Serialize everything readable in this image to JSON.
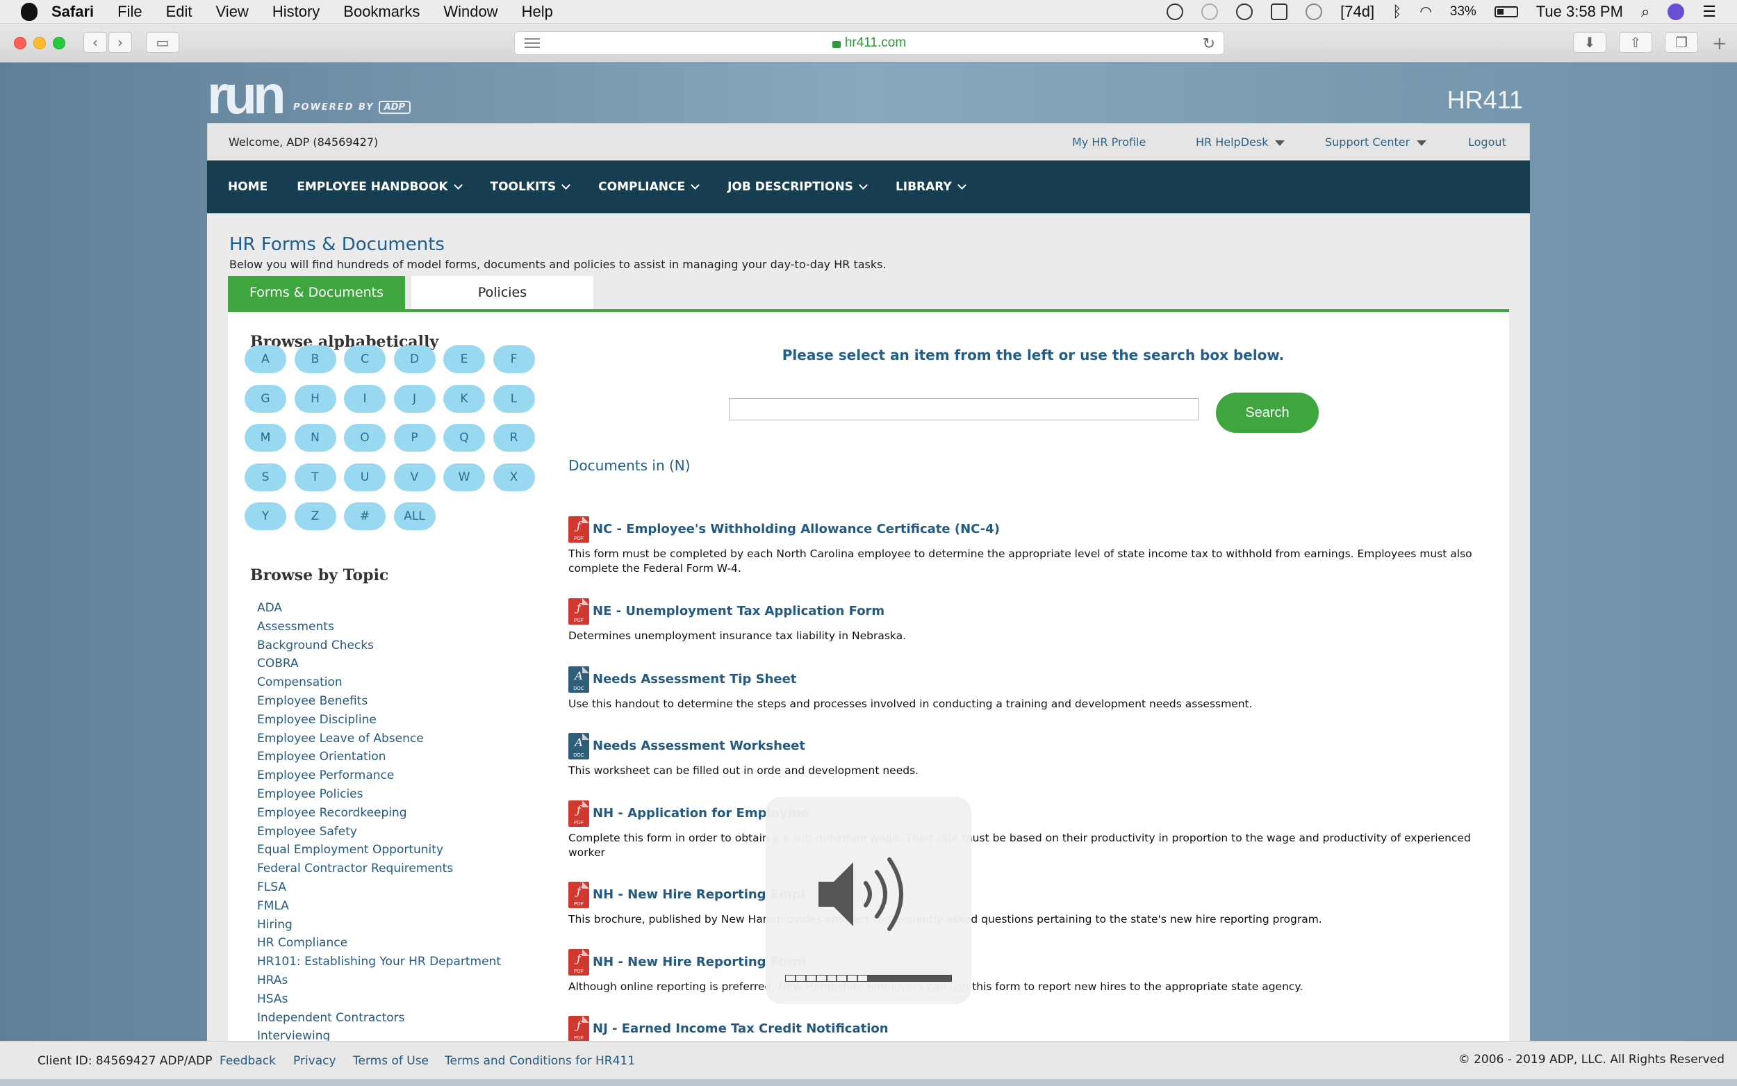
{
  "menubar": {
    "items": [
      "Safari",
      "File",
      "Edit",
      "View",
      "History",
      "Bookmarks",
      "Window",
      "Help"
    ],
    "status_text": "[74d]",
    "battery": "33%",
    "clock": "Tue 3:58 PM"
  },
  "browser": {
    "url": "hr411.com"
  },
  "brand": {
    "logo": "run",
    "powered": "POWERED BY",
    "adp": "ADP",
    "product": "HR411"
  },
  "utility": {
    "welcome": "Welcome, ADP (84569427)",
    "links": [
      "My HR Profile",
      "HR HelpDesk",
      "Support Center",
      "Logout"
    ]
  },
  "nav": {
    "items": [
      "HOME",
      "EMPLOYEE HANDBOOK",
      "TOOLKITS",
      "COMPLIANCE",
      "JOB DESCRIPTIONS",
      "LIBRARY"
    ]
  },
  "main": {
    "title": "HR Forms & Documents",
    "subtitle": "Below you will find hundreds of model forms, documents and policies to assist in managing your day-to-day HR tasks.",
    "tabs": [
      "Forms & Documents",
      "Policies"
    ],
    "browse_alpha_heading": "Browse alphabetically",
    "letters": [
      "A",
      "B",
      "C",
      "D",
      "E",
      "F",
      "G",
      "H",
      "I",
      "J",
      "K",
      "L",
      "M",
      "N",
      "O",
      "P",
      "Q",
      "R",
      "S",
      "T",
      "U",
      "V",
      "W",
      "X",
      "Y",
      "Z",
      "#",
      "ALL"
    ],
    "browse_topic_heading": "Browse by Topic",
    "topics": [
      "ADA",
      "Assessments",
      "Background Checks",
      "COBRA",
      "Compensation",
      "Employee Benefits",
      "Employee Discipline",
      "Employee Leave of Absence",
      "Employee Orientation",
      "Employee Performance",
      "Employee Policies",
      "Employee Recordkeeping",
      "Employee Safety",
      "Equal Employment Opportunity",
      "Federal Contractor Requirements",
      "FLSA",
      "FMLA",
      "Hiring",
      "HR Compliance",
      "HR101: Establishing Your HR Department",
      "HRAs",
      "HSAs",
      "Independent Contractors",
      "Interviewing"
    ],
    "prompt": "Please select an item from the left or use the search box below.",
    "search_placeholder": "",
    "search_button": "Search",
    "docs_heading": "Documents in (N)",
    "documents": [
      {
        "type": "pdf",
        "title": "NC - Employee's Withholding Allowance Certificate (NC-4)",
        "desc": "This form must be completed by each North Carolina employee to determine the appropriate level of state income tax to withhold from earnings. Employees must also complete the Federal Form W-4."
      },
      {
        "type": "pdf",
        "title": "NE - Unemployment Tax Application Form",
        "desc": "Determines unemployment insurance tax liability in Nebraska."
      },
      {
        "type": "doc",
        "title": "Needs Assessment Tip Sheet",
        "desc": "Use this handout to determine the steps and processes involved in conducting a training and development needs assessment."
      },
      {
        "type": "doc",
        "title": "Needs Assessment Worksheet",
        "desc": "This worksheet can be filled out in orde                                                    and development needs."
      },
      {
        "type": "pdf",
        "title": "NH - Application for Employme",
        "desc": "Complete this form in order to obtain a                                                   a sub-minimum wage. Their rate must be based on their productivity in proportion to the wage and productivity of experienced worker"
      },
      {
        "type": "pdf",
        "title": "NH - New Hire Reporting Empl",
        "desc": "This brochure, published by New Hamp.                                                     ovides answers to frequently asked questions pertaining to the state's new hire reporting program."
      },
      {
        "type": "pdf",
        "title": "NH - New Hire Reporting Form",
        "desc": "Although online reporting is preferred, New Hampshire employers can use this form to report new hires to the appropriate state agency."
      },
      {
        "type": "pdf",
        "title": "NJ - Earned Income Tax Credit Notification",
        "desc": ""
      }
    ]
  },
  "volume": {
    "level": 0.5,
    "icon": "speaker-icon"
  },
  "footer": {
    "client": "Client ID: 84569427 ADP/ADP",
    "links": [
      "Feedback",
      "Privacy",
      "Terms of Use",
      "Terms and Conditions for HR411"
    ],
    "copyright": "© 2006 - 2019 ADP, LLC. All Rights Reserved"
  }
}
